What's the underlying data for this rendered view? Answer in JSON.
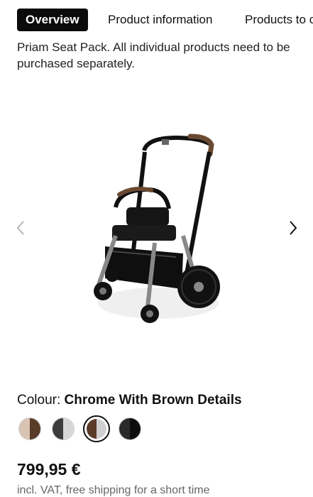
{
  "tabs": [
    {
      "label": "Overview",
      "active": true
    },
    {
      "label": "Product information",
      "active": false
    },
    {
      "label": "Products to c",
      "active": false
    }
  ],
  "intro_text": "Priam Seat Pack. All individual products need to be purchased separately.",
  "carousel": {
    "prev_icon": "chevron-left-icon",
    "next_icon": "chevron-right-icon",
    "image_icon": "stroller-frame-image"
  },
  "colour": {
    "label": "Colour:",
    "selected_value": "Chrome With Brown Details",
    "swatches": [
      {
        "left": "#b8a08c",
        "right": "#5a3b2a",
        "selected": false
      },
      {
        "left": "#7a7a7a",
        "right": "#d8d8d8",
        "selected": false
      },
      {
        "left": "#5a3b2a",
        "right": "#cfcfcf",
        "selected": true
      },
      {
        "left": "#1a1a1a",
        "right": "#111111",
        "selected": false
      }
    ]
  },
  "price": {
    "amount": "799,95 €",
    "note": "incl. VAT, free shipping for a short time"
  },
  "colors": {
    "tab_active_bg": "#0b0b0b",
    "text": "#111111",
    "muted": "#666666"
  }
}
